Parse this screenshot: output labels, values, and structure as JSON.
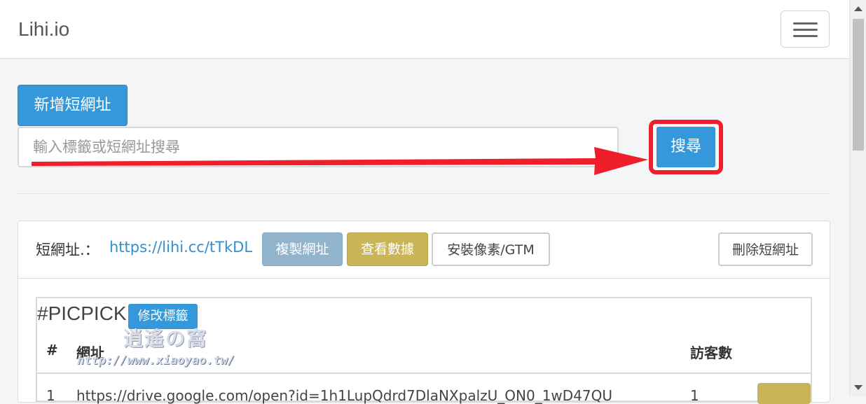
{
  "navbar": {
    "brand": "Lihi.io",
    "menu_icon": "hamburger-icon"
  },
  "toolbar": {
    "new_short_url_label": "新增短網址"
  },
  "search": {
    "placeholder": "輸入標籤或短網址搜尋",
    "button_label": "搜尋"
  },
  "card": {
    "short_url_label": "短網址.：",
    "short_url": "https://lihi.cc/tTkDL",
    "copy_label": "複製網址",
    "stats_label": "查看數據",
    "pixel_label": "安裝像素/GTM",
    "delete_label": "刪除短網址"
  },
  "tag": {
    "name": "#PICPICK",
    "edit_label": "修改標籤"
  },
  "table": {
    "headers": [
      "#",
      "網址",
      "訪客數"
    ],
    "rows": [
      {
        "index": "1",
        "url": "https://drive.google.com/open?id=1h1LupQdrd7DlaNXpalzU_ON0_1wD47QU",
        "visits": "1"
      }
    ]
  },
  "watermark": {
    "logo": "逍遙の窩",
    "url": "http://www.xiaoyao.tw/"
  },
  "colors": {
    "primary": "#3498db",
    "highlight": "#ee1f2a",
    "stats": "#c9b457",
    "copy": "#92b3cc"
  }
}
